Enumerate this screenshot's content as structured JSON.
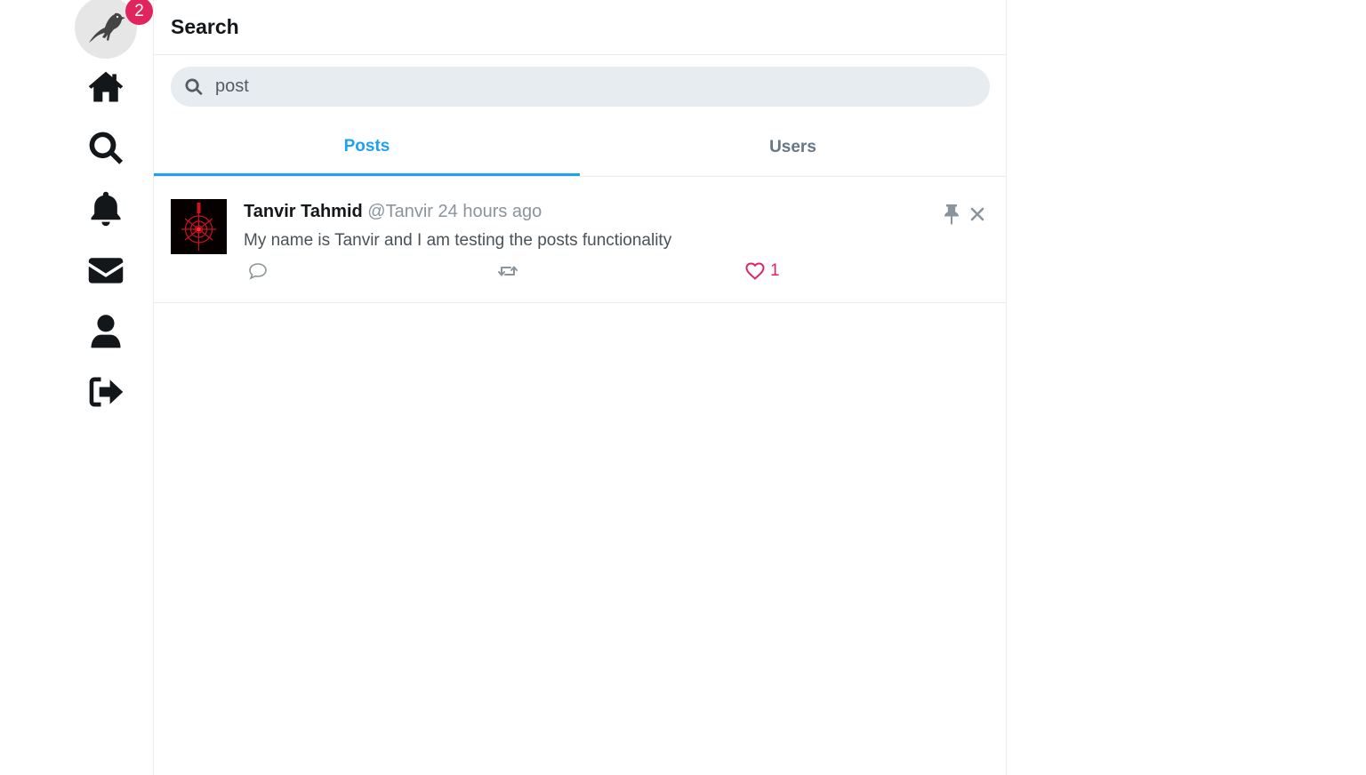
{
  "nav": {
    "logo_icon": "bird-icon",
    "notification_badge": "2",
    "items": [
      {
        "icon": "home-icon"
      },
      {
        "icon": "search-icon"
      },
      {
        "icon": "bell-icon"
      },
      {
        "icon": "envelope-icon"
      },
      {
        "icon": "user-icon"
      },
      {
        "icon": "logout-icon"
      }
    ]
  },
  "header": {
    "title": "Search"
  },
  "search": {
    "value": "post",
    "icon": "search-icon"
  },
  "tabs": [
    {
      "label": "Posts",
      "active": true
    },
    {
      "label": "Users",
      "active": false
    }
  ],
  "post": {
    "display_name": "Tanvir Tahmid",
    "username": "@Tanvir",
    "timestamp": "24 hours ago",
    "content": "My name is Tanvir and I am testing the posts functionality",
    "like_count": "1",
    "liked": true,
    "actions": [
      "comment-icon",
      "retweet-icon",
      "heart-icon"
    ],
    "controls": [
      "pin-icon",
      "close-icon"
    ]
  },
  "colors": {
    "accent": "#1da1f2",
    "like": "#e0245e",
    "badge": "#e0245e",
    "search_bg": "#e6ecf0"
  }
}
